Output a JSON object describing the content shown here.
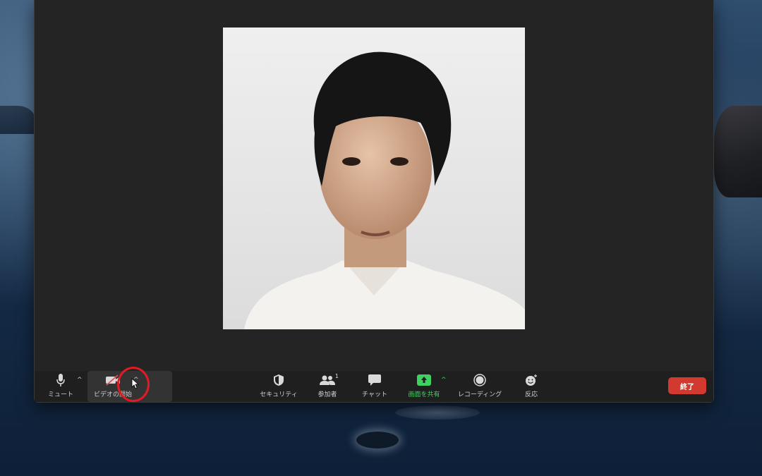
{
  "desktop": {
    "wallpaper": "macOS Catalina coastline"
  },
  "toolbar": {
    "mute_label": "ミュート",
    "video_label": "ビデオの開始",
    "security_label": "セキュリティ",
    "participants_label": "参加者",
    "participants_count": "1",
    "chat_label": "チャット",
    "share_label": "画面を共有",
    "record_label": "レコーディング",
    "reactions_label": "反応",
    "end_label": "終了"
  },
  "colors": {
    "share_green": "#3fd160",
    "end_red": "#d23a2f",
    "highlight_red": "#e01b24",
    "window_bg": "#242424"
  },
  "icons": {
    "mute": "microphone-icon",
    "video": "video-off-icon",
    "security": "shield-icon",
    "participants": "people-icon",
    "chat": "chat-bubble-icon",
    "share": "share-screen-icon",
    "record": "record-icon",
    "reactions": "emoji-icon"
  }
}
